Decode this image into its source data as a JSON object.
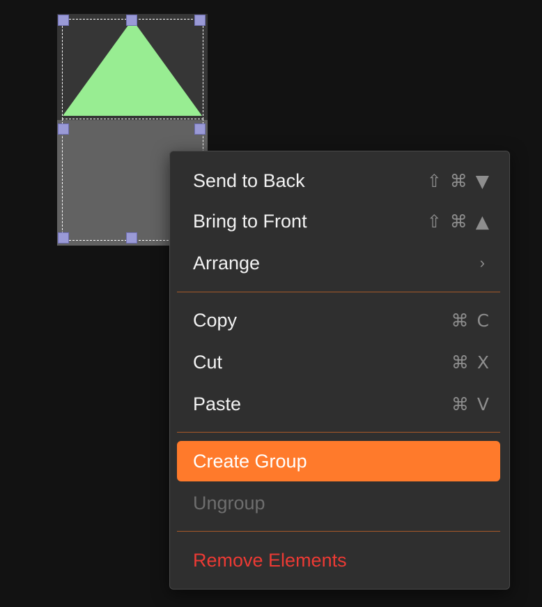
{
  "menu": {
    "items": [
      {
        "label": "Send to Back",
        "shortcut": [
          "⇧",
          "⌘",
          "▼"
        ]
      },
      {
        "label": "Bring to Front",
        "shortcut": [
          "⇧",
          "⌘",
          "▲"
        ]
      },
      {
        "label": "Arrange",
        "submenu_indicator": "›"
      },
      {
        "label": "Copy",
        "shortcut": [
          "⌘",
          "C"
        ]
      },
      {
        "label": "Cut",
        "shortcut": [
          "⌘",
          "X"
        ]
      },
      {
        "label": "Paste",
        "shortcut": [
          "⌘",
          "V"
        ]
      },
      {
        "label": "Create Group",
        "state": "highlighted"
      },
      {
        "label": "Ungroup",
        "state": "disabled"
      },
      {
        "label": "Remove Elements",
        "state": "destructive"
      }
    ]
  },
  "canvas": {
    "triangle_color": "#98ed92",
    "rect_color": "#626262",
    "handle_color": "#9a9ad6",
    "accent_color": "#ff7a2b",
    "danger_color": "#ec3a34"
  }
}
